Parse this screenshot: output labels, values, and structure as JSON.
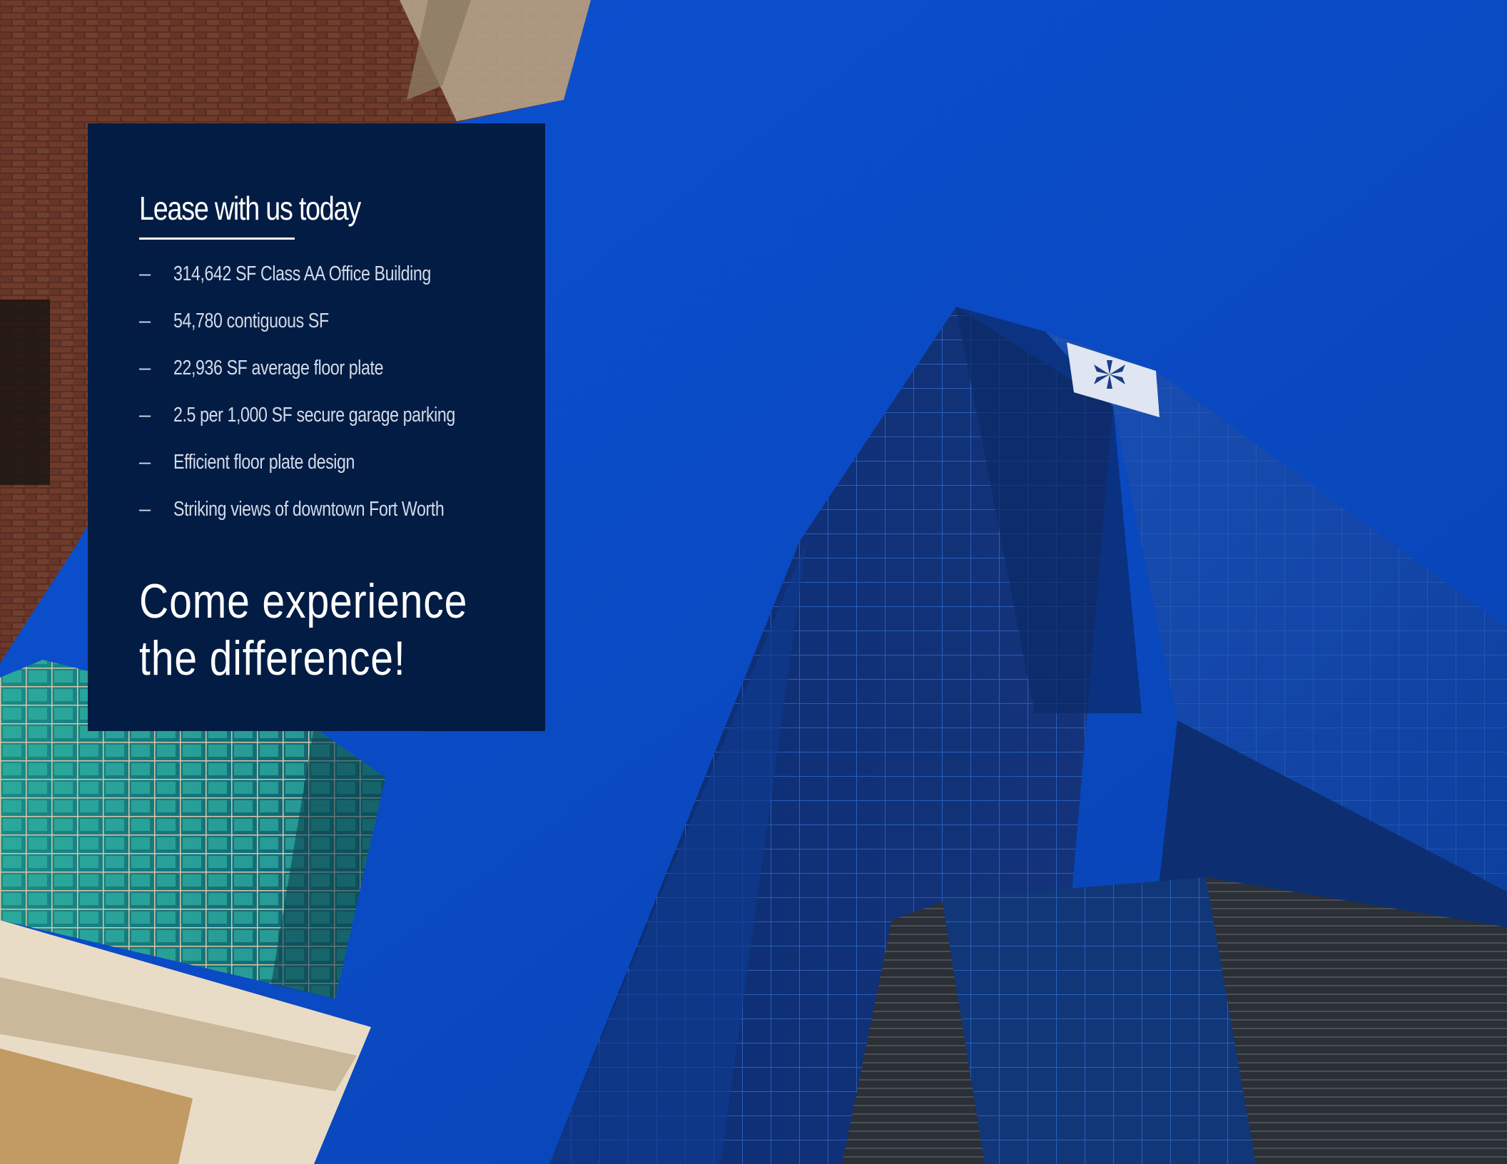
{
  "panel": {
    "title": "Lease with us today",
    "features": [
      "314,642 SF Class AA Office Building",
      "54,780 contiguous SF",
      "22,936 SF average floor plate",
      "2.5 per 1,000 SF secure garage parking",
      "Efficient floor plate design",
      "Striking views of downtown Fort Worth"
    ],
    "bullet": "–",
    "cta_line1": "Come experience",
    "cta_line2": "the difference!"
  },
  "colors": {
    "sky": "#0a4bc7",
    "panel": "#031c44",
    "text": "#ffffff",
    "list_text": "#d3dae8"
  }
}
